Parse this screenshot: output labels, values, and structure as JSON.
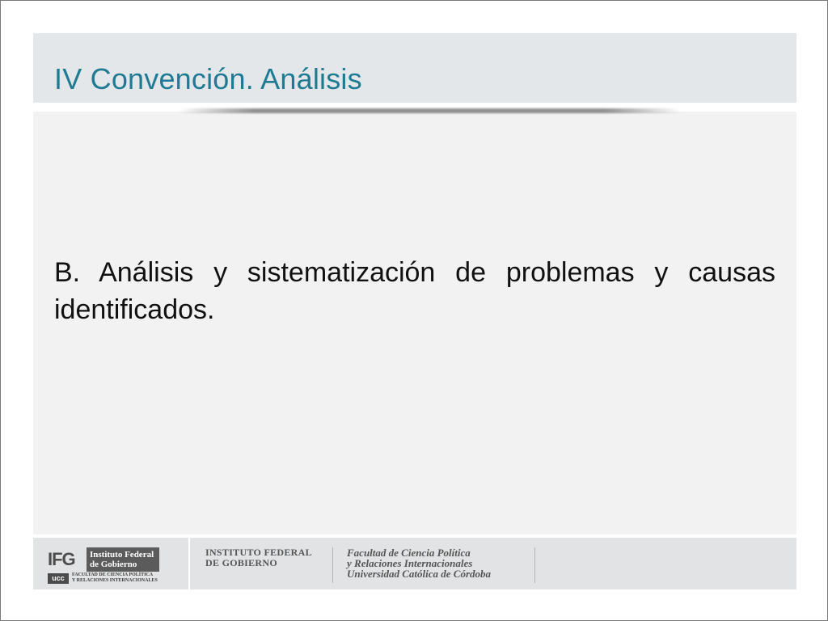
{
  "slide": {
    "title": "IV Convención. Análisis",
    "body": "B. Análisis y sistematización de problemas y causas identificados."
  },
  "footer": {
    "ifg_letters": "IFG",
    "ifg_name_line1": "Instituto Federal",
    "ifg_name_line2": "de Gobierno",
    "ucc": "ucc",
    "ucc_line1": "FACULTAD DE CIENCIA POLÍTICA",
    "ucc_line2": "Y RELACIONES INTERNACIONALES",
    "institute_line1": "INSTITUTO FEDERAL",
    "institute_line2": "DE GOBIERNO",
    "faculty_line1": "Facultad de Ciencia Política",
    "faculty_line2": "y Relaciones Internacionales",
    "faculty_line3": "Universidad Católica de Córdoba"
  },
  "colors": {
    "title": "#1f7a93",
    "title_band": "#e4e7ea",
    "content_bg": "#f2f2f2",
    "footer_bg": "#e2e3e4"
  }
}
